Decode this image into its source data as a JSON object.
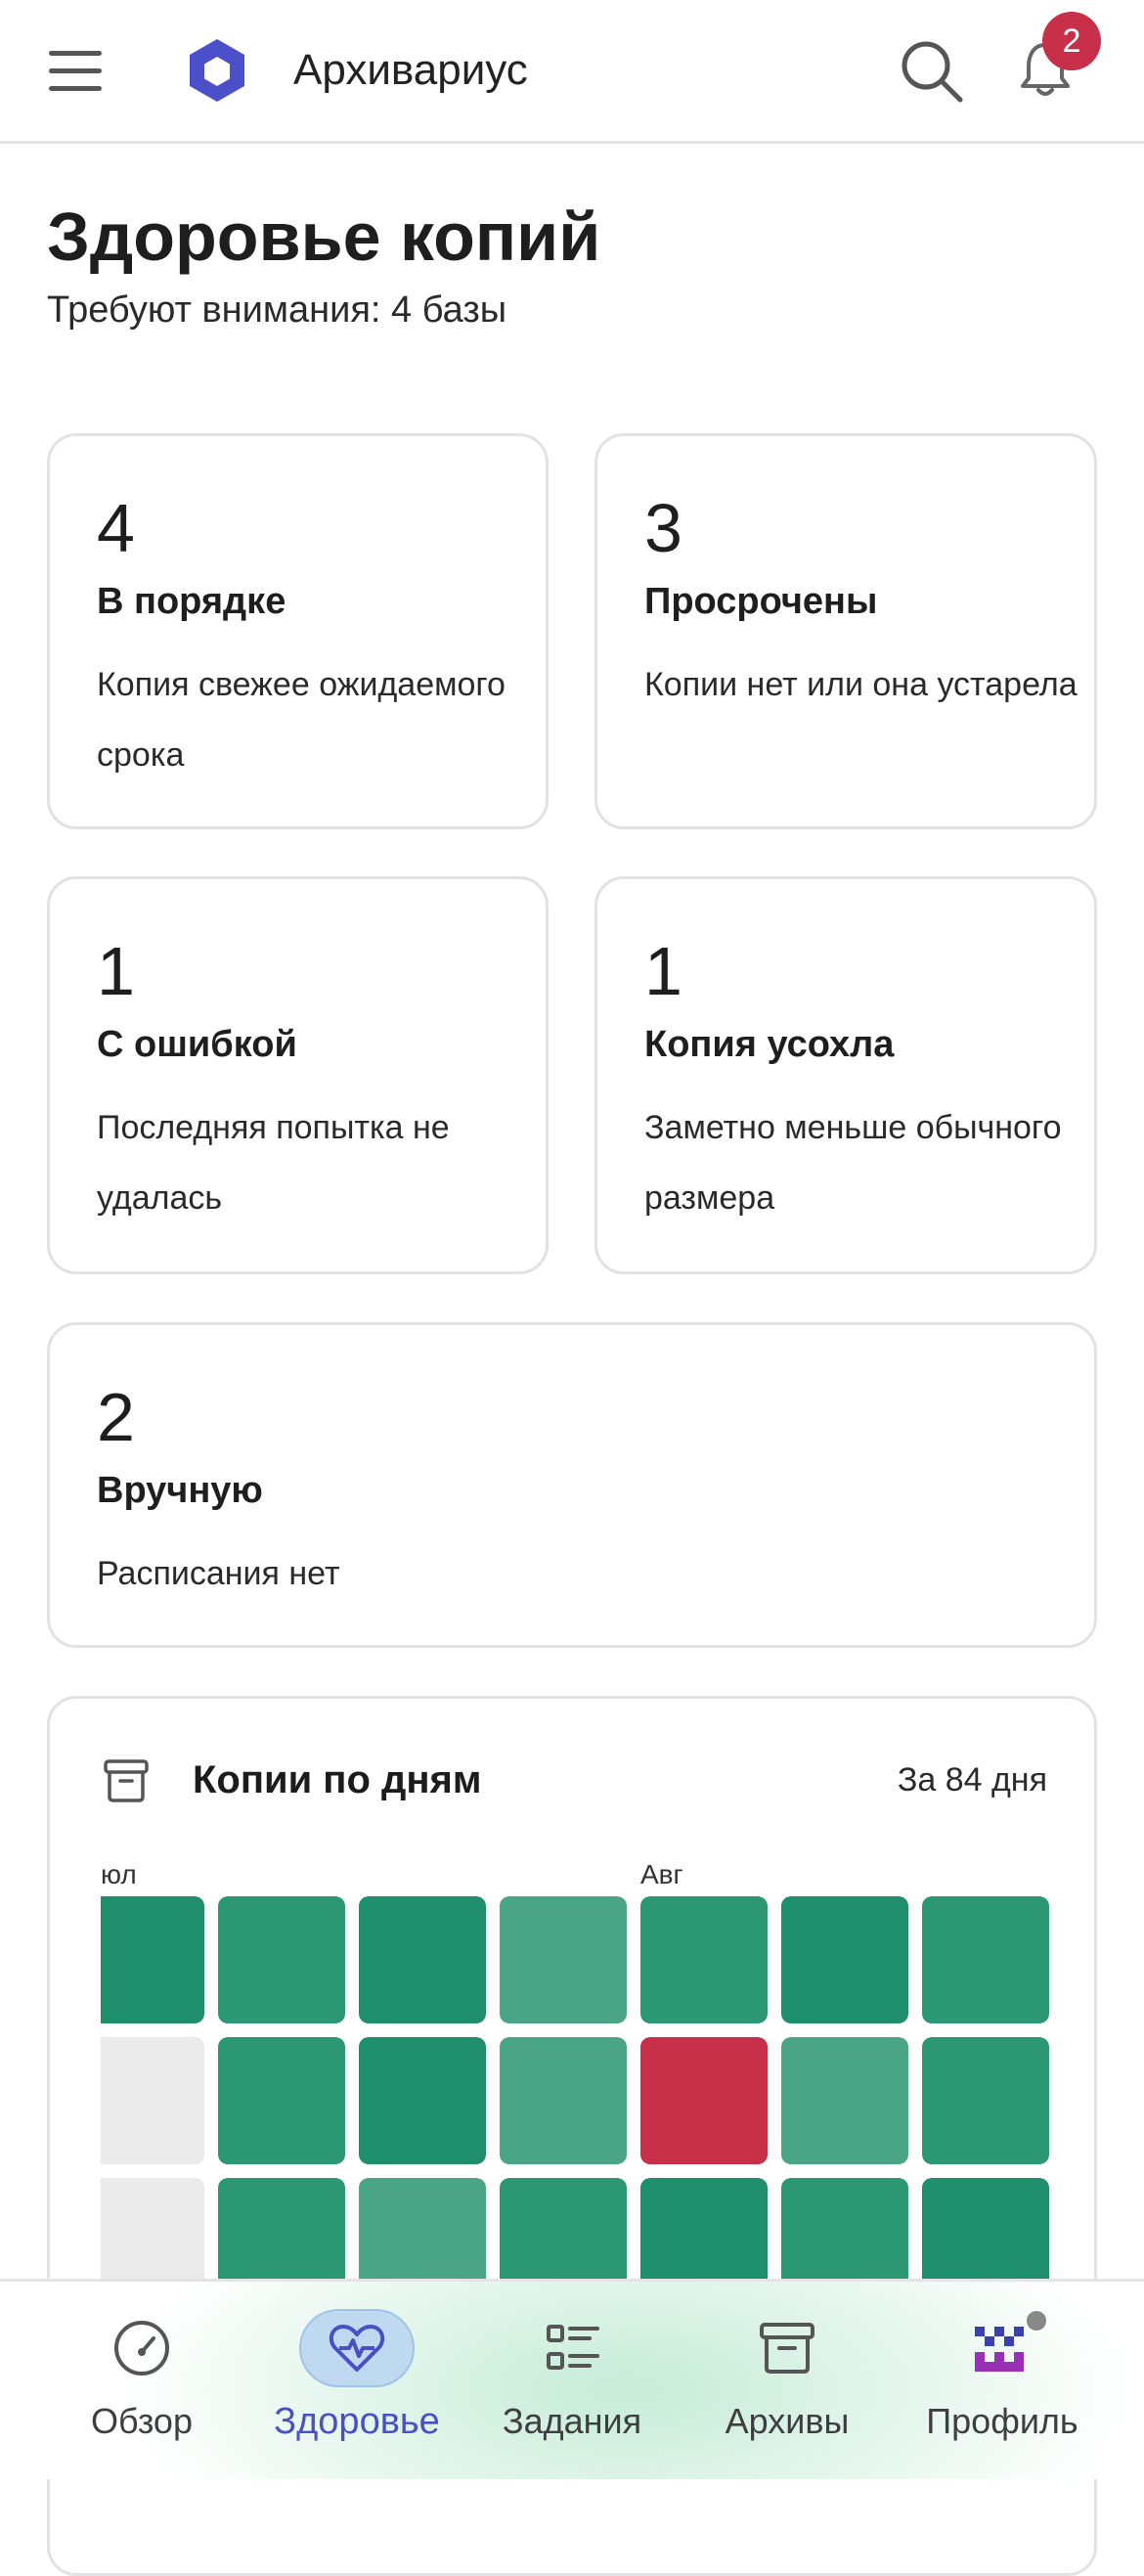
{
  "header": {
    "app_name": "Архивариус",
    "notification_count": "2"
  },
  "page": {
    "title": "Здоровье копий",
    "subtitle": "Требуют внимания: 4 базы"
  },
  "stats": [
    {
      "count": "4",
      "label": "В порядке",
      "description": "Копия свежее ожидаемого срока"
    },
    {
      "count": "3",
      "label": "Просрочены",
      "description": "Копии нет или она устарела"
    },
    {
      "count": "1",
      "label": "С ошибкой",
      "description": "Последняя попытка не удалась"
    },
    {
      "count": "1",
      "label": "Копия усохла",
      "description": "Заметно меньше обычного размера"
    },
    {
      "count": "2",
      "label": "Вручную",
      "description": "Расписания нет"
    }
  ],
  "heatmap": {
    "icon": "archive-box-icon",
    "title": "Копии по дням",
    "range": "За 84 дня",
    "months": [
      {
        "label": "юл",
        "column": 0
      },
      {
        "label": "Авг",
        "column": 4
      }
    ],
    "levels": {
      "none": "#eaeaea",
      "light": "#4aa586",
      "medium": "#2c9873",
      "dark": "#1e8f6a",
      "error": "#c8304a"
    },
    "rows": [
      [
        "dark",
        "medium",
        "dark",
        "light",
        "medium",
        "dark",
        "medium"
      ],
      [
        "none",
        "medium",
        "dark",
        "light",
        "error",
        "light",
        "medium"
      ],
      [
        "none",
        "medium",
        "light",
        "medium",
        "dark",
        "medium",
        "dark"
      ]
    ]
  },
  "nav": {
    "items": [
      {
        "label": "Обзор",
        "icon": "gauge-icon"
      },
      {
        "label": "Здоровье",
        "icon": "heart-pulse-icon",
        "active": true
      },
      {
        "label": "Задания",
        "icon": "task-list-icon"
      },
      {
        "label": "Архивы",
        "icon": "archive-box-icon"
      },
      {
        "label": "Профиль",
        "icon": "avatar-icon"
      }
    ]
  }
}
